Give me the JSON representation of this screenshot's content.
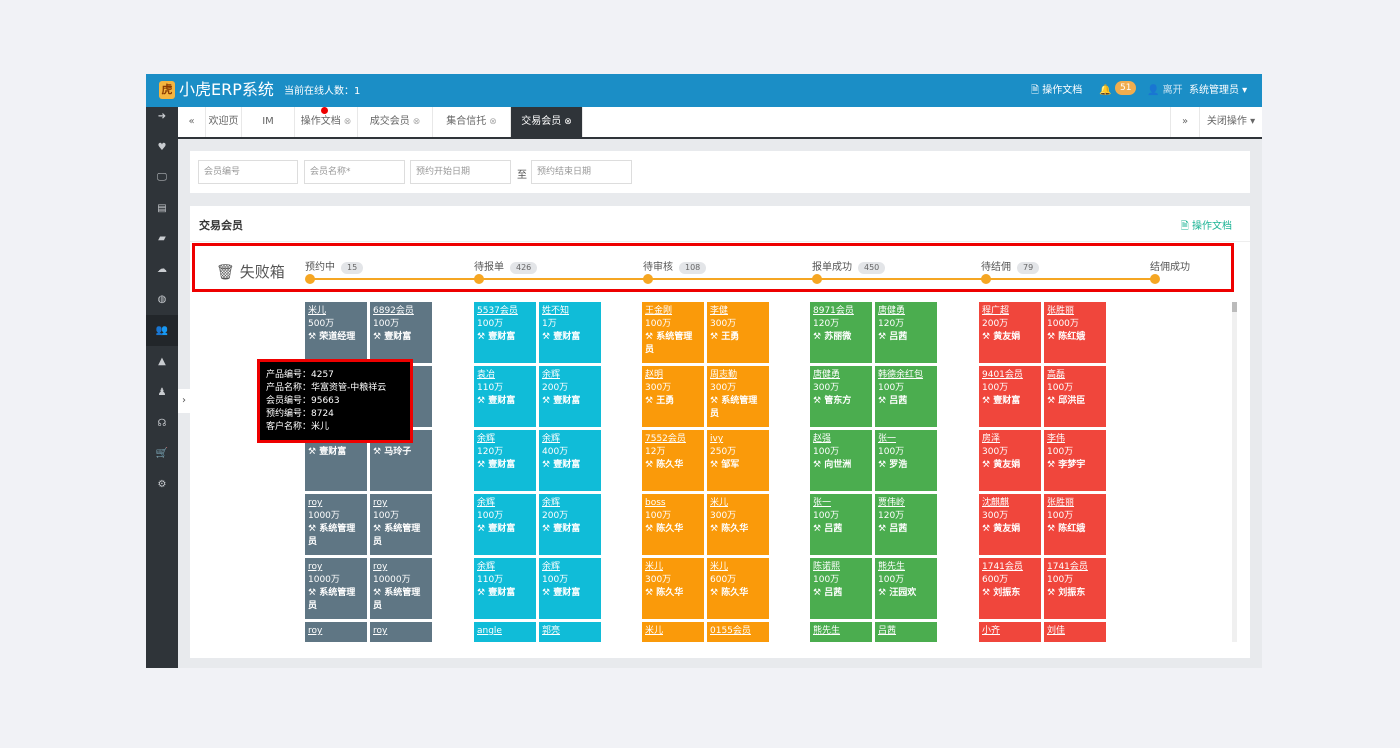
{
  "app": {
    "title": "小虎ERP系统",
    "online": "当前在线人数：1"
  },
  "topbar": {
    "doc": "🗎 操作文档",
    "bell": "🔔",
    "badge": "51",
    "leave": "👤 离开",
    "admin": "系统管理员 ▾"
  },
  "sidebar": {
    "icons": [
      "arrow-right-icon",
      "heart-icon",
      "monitor-icon",
      "table-icon",
      "book-icon",
      "cloud-upload-icon",
      "globe-icon",
      "users-icon",
      "car-icon",
      "user-icon",
      "headphones-icon",
      "cart-icon",
      "gear-icon"
    ],
    "glyphs": [
      "➜",
      "♥",
      "🖵",
      "▤",
      "▰",
      "☁",
      "◍",
      "👥",
      "▲",
      "♟",
      "☊",
      "🛒",
      "⚙"
    ],
    "active_index": 7
  },
  "tabs": {
    "prev": "«",
    "items": [
      {
        "label": "欢迎页",
        "closable": false
      },
      {
        "label": "IM",
        "closable": false
      },
      {
        "label": "操作文档",
        "closable": true
      },
      {
        "label": "成交会员",
        "closable": true
      },
      {
        "label": "集合信托",
        "closable": true
      },
      {
        "label": "交易会员",
        "closable": true,
        "active": true
      }
    ],
    "next": "»",
    "close_ops": "关闭操作 ▾",
    "close_glyph": "⊗"
  },
  "filter": {
    "member_no": "会员编号",
    "member_name": "会员名称*",
    "start_date": "预约开始日期",
    "to": "至",
    "end_date": "预约结束日期"
  },
  "panel": {
    "title": "交易会员",
    "doc_link": "🗎 操作文档"
  },
  "pipeline": {
    "fail_box": "🗑 失败箱",
    "stages": [
      {
        "label": "预约中",
        "count": "15"
      },
      {
        "label": "待报单",
        "count": "426"
      },
      {
        "label": "待审核",
        "count": "108"
      },
      {
        "label": "报单成功",
        "count": "450"
      },
      {
        "label": "待结佣",
        "count": "79"
      },
      {
        "label": "结佣成功",
        "count": ""
      }
    ]
  },
  "colors": {
    "grey": "#5f7684",
    "cyan": "#10bcd8",
    "orange": "#fa9a0a",
    "green": "#4bad4f",
    "red": "#f0463c",
    "topbar": "#1b8ec6",
    "sidebar": "#2f3439",
    "highlight": "#ee0000"
  },
  "columns": [
    {
      "color": "grey",
      "cards": [
        {
          "name": "米儿",
          "amount": "500万",
          "agent": "荣道经理"
        },
        {
          "name": "6892会员",
          "amount": "100万",
          "agent": "壹财富"
        },
        {
          "name": "",
          "amount": "",
          "agent": ""
        },
        {
          "name": "",
          "amount": "",
          "agent": ""
        },
        {
          "name": "",
          "amount": "100万",
          "agent": "壹财富"
        },
        {
          "name": "",
          "amount": "100万",
          "agent": "马玲子"
        },
        {
          "name": "roy",
          "amount": "1000万",
          "agent": "系统管理员"
        },
        {
          "name": "roy",
          "amount": "100万",
          "agent": "系统管理员"
        },
        {
          "name": "roy",
          "amount": "1000万",
          "agent": "系统管理员"
        },
        {
          "name": "roy",
          "amount": "10000万",
          "agent": "系统管理员"
        },
        {
          "name": "roy",
          "amount": "",
          "agent": ""
        },
        {
          "name": "roy",
          "amount": "",
          "agent": ""
        }
      ]
    },
    {
      "color": "cyan",
      "cards": [
        {
          "name": "5537会员",
          "amount": "100万",
          "agent": "壹财富"
        },
        {
          "name": "姓不知",
          "amount": "1万",
          "agent": "壹财富"
        },
        {
          "name": "袁冶",
          "amount": "110万",
          "agent": "壹财富"
        },
        {
          "name": "余辉",
          "amount": "200万",
          "agent": "壹财富"
        },
        {
          "name": "余辉",
          "amount": "120万",
          "agent": "壹财富"
        },
        {
          "name": "余辉",
          "amount": "400万",
          "agent": "壹财富"
        },
        {
          "name": "余辉",
          "amount": "100万",
          "agent": "壹财富"
        },
        {
          "name": "余辉",
          "amount": "200万",
          "agent": "壹财富"
        },
        {
          "name": "余辉",
          "amount": "110万",
          "agent": "壹财富"
        },
        {
          "name": "余辉",
          "amount": "100万",
          "agent": "壹财富"
        },
        {
          "name": "angle",
          "amount": "",
          "agent": ""
        },
        {
          "name": "郭亮",
          "amount": "",
          "agent": ""
        }
      ]
    },
    {
      "color": "orange",
      "cards": [
        {
          "name": "王金刚",
          "amount": "100万",
          "agent": "系统管理员"
        },
        {
          "name": "李健",
          "amount": "300万",
          "agent": "王勇"
        },
        {
          "name": "赵明",
          "amount": "300万",
          "agent": "王勇"
        },
        {
          "name": "周志勤",
          "amount": "300万",
          "agent": "系统管理员"
        },
        {
          "name": "7552会员",
          "amount": "12万",
          "agent": "陈久华"
        },
        {
          "name": "ivy",
          "amount": "250万",
          "agent": "邹军"
        },
        {
          "name": "boss",
          "amount": "100万",
          "agent": "陈久华"
        },
        {
          "name": "米儿",
          "amount": "300万",
          "agent": "陈久华"
        },
        {
          "name": "米儿",
          "amount": "300万",
          "agent": "陈久华"
        },
        {
          "name": "米儿",
          "amount": "600万",
          "agent": "陈久华"
        },
        {
          "name": "米儿",
          "amount": "",
          "agent": ""
        },
        {
          "name": "0155会员",
          "amount": "",
          "agent": ""
        }
      ]
    },
    {
      "color": "green",
      "cards": [
        {
          "name": "8971会员",
          "amount": "120万",
          "agent": "苏丽微"
        },
        {
          "name": "唐健勇",
          "amount": "120万",
          "agent": "吕茜"
        },
        {
          "name": "唐健勇",
          "amount": "300万",
          "agent": "管东方"
        },
        {
          "name": "韩德余红包",
          "amount": "100万",
          "agent": "吕茜"
        },
        {
          "name": "赵强",
          "amount": "100万",
          "agent": "向世洲"
        },
        {
          "name": "张一",
          "amount": "100万",
          "agent": "罗浩"
        },
        {
          "name": "张一",
          "amount": "100万",
          "agent": "吕茜"
        },
        {
          "name": "贾伟岭",
          "amount": "120万",
          "agent": "吕茜"
        },
        {
          "name": "陈诺熙",
          "amount": "100万",
          "agent": "吕茜"
        },
        {
          "name": "熊先生",
          "amount": "100万",
          "agent": "汪园欢"
        },
        {
          "name": "熊先生",
          "amount": "",
          "agent": ""
        },
        {
          "name": "吕茜",
          "amount": "",
          "agent": ""
        }
      ]
    },
    {
      "color": "red",
      "cards": [
        {
          "name": "程广超",
          "amount": "200万",
          "agent": "黄友娟"
        },
        {
          "name": "张胜丽",
          "amount": "1000万",
          "agent": "陈红娥"
        },
        {
          "name": "9401会员",
          "amount": "100万",
          "agent": "壹财富"
        },
        {
          "name": "高磊",
          "amount": "100万",
          "agent": "邱洪臣"
        },
        {
          "name": "房泽",
          "amount": "300万",
          "agent": "黄友娟"
        },
        {
          "name": "李伟",
          "amount": "100万",
          "agent": "李梦宇"
        },
        {
          "name": "沈麒麒",
          "amount": "300万",
          "agent": "黄友娟"
        },
        {
          "name": "张胜丽",
          "amount": "100万",
          "agent": "陈红娥"
        },
        {
          "name": "1741会员",
          "amount": "600万",
          "agent": "刘振东"
        },
        {
          "name": "1741会员",
          "amount": "100万",
          "agent": "刘振东"
        },
        {
          "name": "小齐",
          "amount": "",
          "agent": ""
        },
        {
          "name": "刘佳",
          "amount": "",
          "agent": ""
        }
      ]
    }
  ],
  "tooltip": {
    "lines": [
      "产品编号：4257",
      "产品名称：华富资管-中粮祥云",
      "会员编号：95663",
      "预约编号：8724",
      "客户名称：米儿"
    ]
  },
  "side_toggle": "›"
}
